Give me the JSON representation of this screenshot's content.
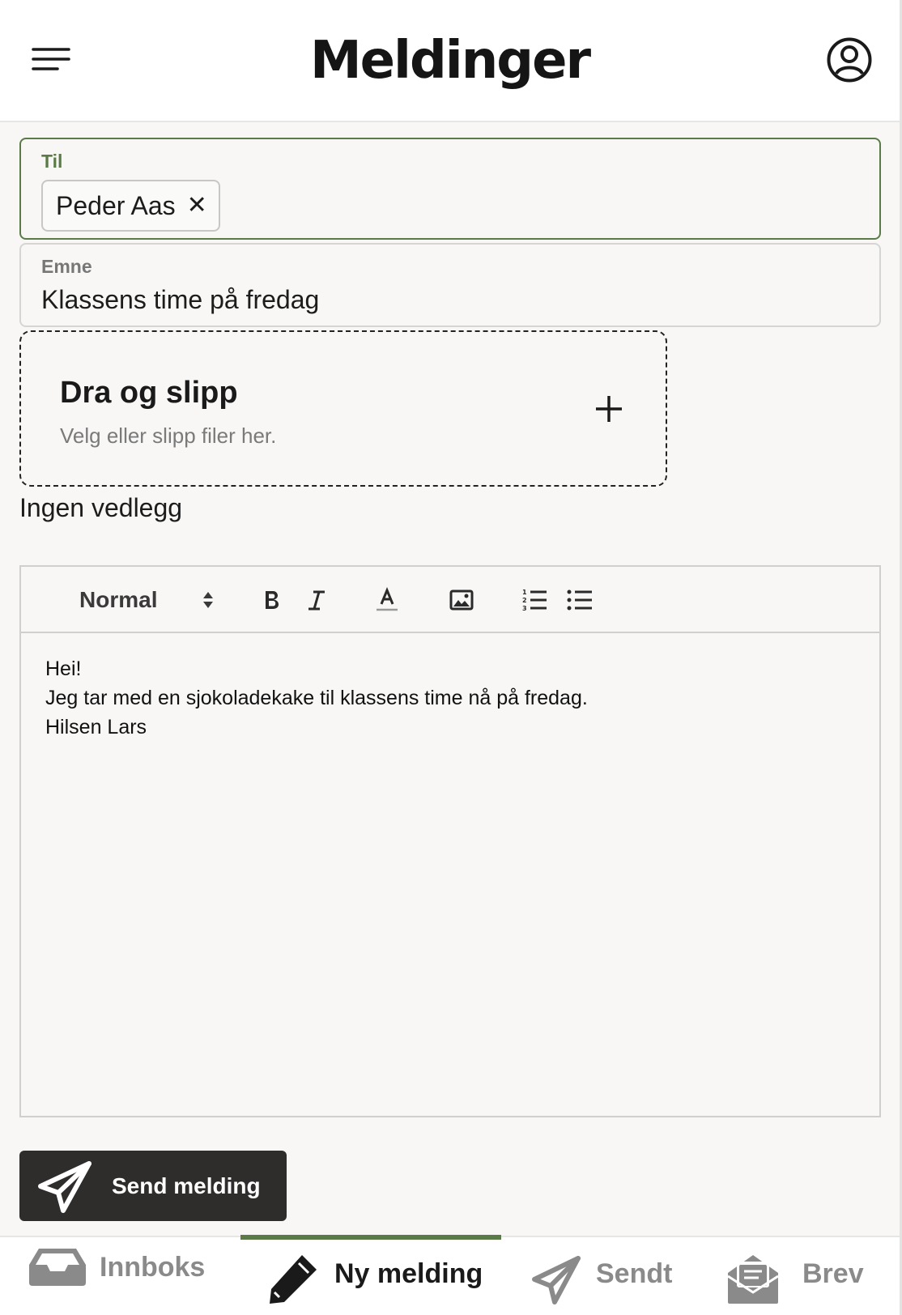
{
  "header": {
    "title": "Meldinger",
    "menu_icon": "hamburger-menu-icon",
    "profile_icon": "user-circle-icon"
  },
  "compose": {
    "to_label": "Til",
    "recipients": [
      "Peder Aas"
    ],
    "remove_glyph": "✕",
    "subject_label": "Emne",
    "subject_value": "Klassens time på fredag"
  },
  "dropzone": {
    "title": "Dra og slipp",
    "subtitle": "Velg eller slipp filer her.",
    "icon": "plus-icon"
  },
  "attachments_status": "Ingen vedlegg",
  "editor": {
    "toolbar": {
      "heading_select": "Normal",
      "buttons": [
        "bold-icon",
        "italic-icon",
        "text-color-icon",
        "image-icon",
        "ordered-list-icon",
        "bullet-list-icon"
      ]
    },
    "body_lines": [
      "Hei!",
      "Jeg tar med en sjokoladekake til klassens time nå på fredag.",
      "Hilsen Lars"
    ]
  },
  "send_button": {
    "label": "Send melding",
    "icon": "paper-plane-icon"
  },
  "bottom_nav": {
    "active": "Ny melding",
    "items": [
      {
        "label": "Innboks",
        "icon": "inbox-tray-icon"
      },
      {
        "label": "Ny melding",
        "icon": "pencil-icon"
      },
      {
        "label": "Sendt",
        "icon": "paper-plane-icon"
      },
      {
        "label": "Brev",
        "icon": "open-envelope-icon"
      }
    ]
  },
  "colors": {
    "accent": "#5a7a48",
    "button_bg": "#2f2d2b",
    "background": "#f8f7f5"
  }
}
